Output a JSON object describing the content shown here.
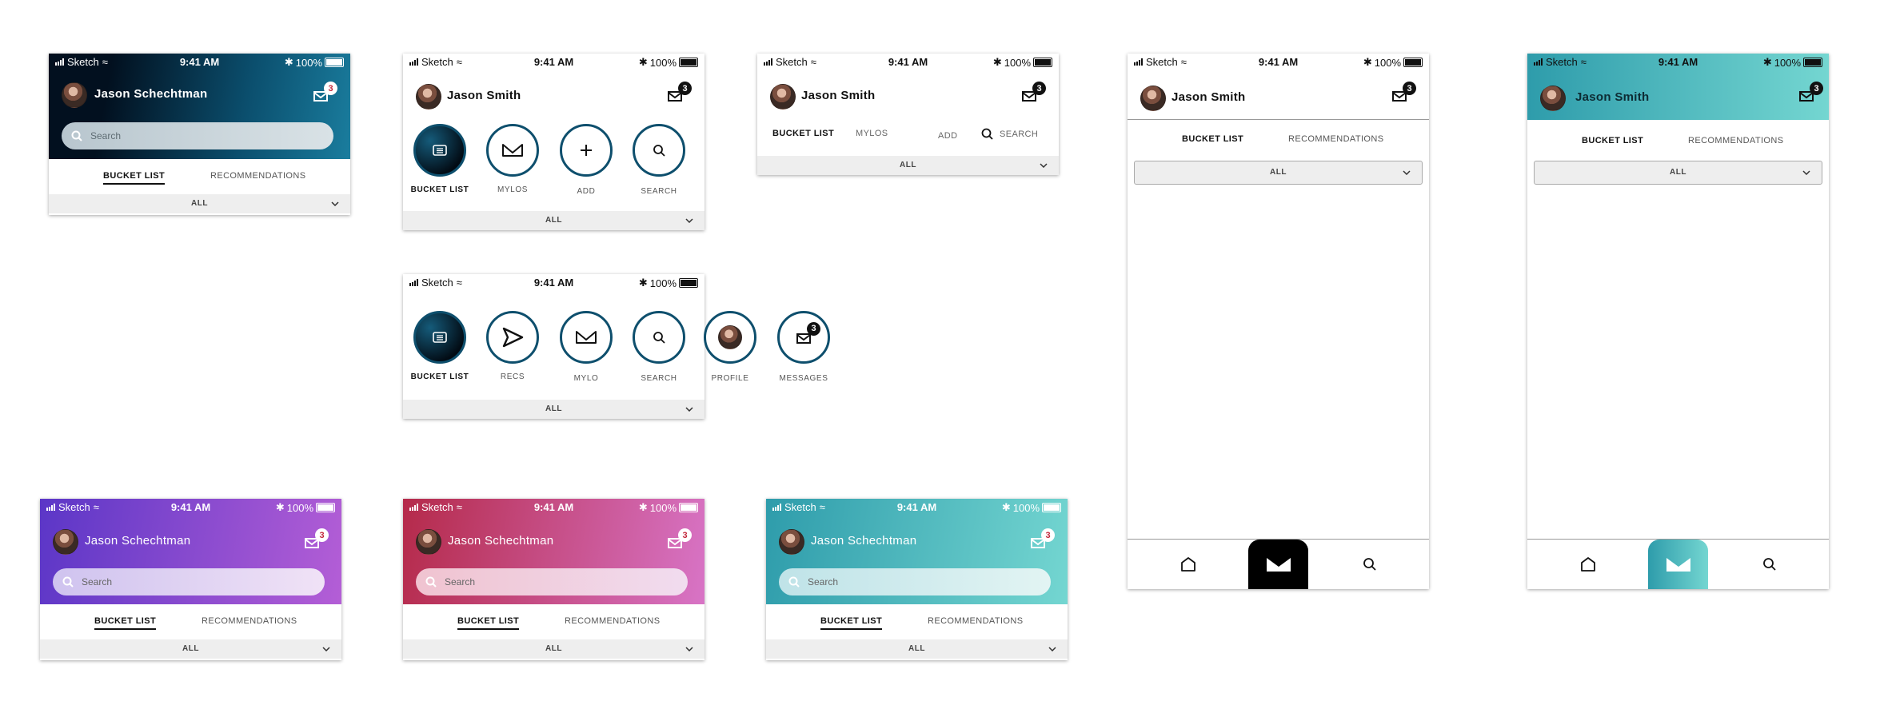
{
  "status": {
    "carrier": "Sketch",
    "time": "9:41 AM",
    "battery": "100%"
  },
  "badge_count": "3",
  "users": {
    "long": "Jason Schechtman",
    "short": "Jason Smith"
  },
  "search_placeholder": "Search",
  "tabs": {
    "bucket_list": "BUCKET LIST",
    "recommendations": "RECOMMENDATIONS"
  },
  "filter_label": "ALL",
  "circle_nav_a": {
    "bucket_list": "BUCKET LIST",
    "mylos": "MYLOS",
    "add": "ADD",
    "search": "SEARCH"
  },
  "inline_nav": {
    "bucket_list": "BUCKET LIST",
    "mylos": "MYLOS",
    "add": "ADD",
    "search": "SEARCH"
  },
  "circle_nav_b": {
    "bucket_list": "BUCKET LIST",
    "recs": "RECS",
    "mylo": "MYLO",
    "search": "SEARCH",
    "profile": "PROFILE",
    "messages": "MESSAGES"
  },
  "colors": {
    "navy_gradient": [
      "#02101f",
      "#0b4f6e",
      "#1a7d9e"
    ],
    "purple_gradient": [
      "#5b36c7",
      "#b45ed6"
    ],
    "crimson_gradient": [
      "#b52a4a",
      "#d874c6"
    ],
    "teal_gradient": [
      "#2e9cab",
      "#74d6d1"
    ],
    "badge_red": "#c2273b"
  }
}
